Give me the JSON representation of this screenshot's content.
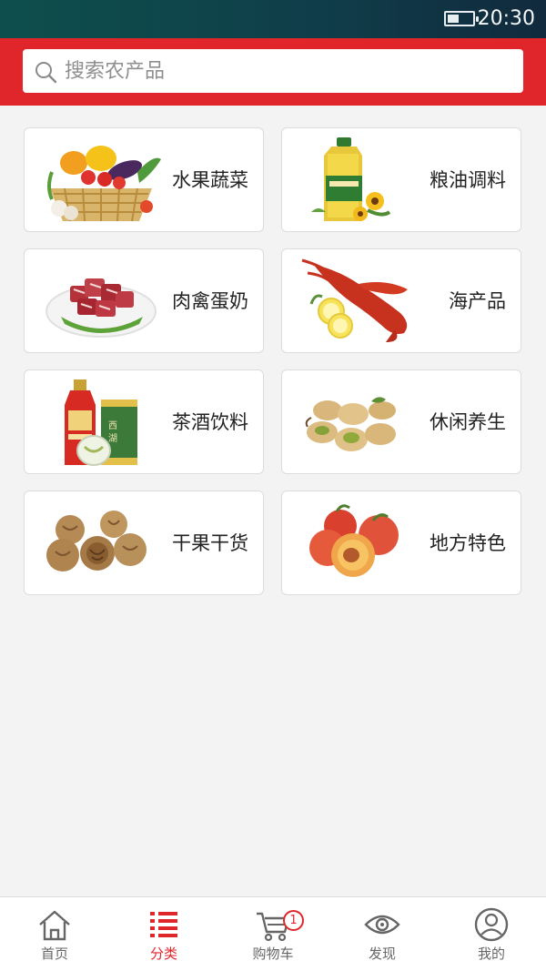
{
  "status_bar": {
    "time": "20:30",
    "battery_icon": "battery-icon"
  },
  "search": {
    "placeholder": "搜索农产品",
    "value": "",
    "icon": "search-icon"
  },
  "categories": [
    {
      "label": "水果蔬菜",
      "icon": "vegetables-basket-image"
    },
    {
      "label": "粮油调料",
      "icon": "cooking-oil-bottle-image"
    },
    {
      "label": "肉禽蛋奶",
      "icon": "meat-plate-image"
    },
    {
      "label": "海产品",
      "icon": "lobster-image"
    },
    {
      "label": "茶酒饮料",
      "icon": "liquor-tea-image"
    },
    {
      "label": "休闲养生",
      "icon": "pistachio-image"
    },
    {
      "label": "干果干货",
      "icon": "walnut-image"
    },
    {
      "label": "地方特色",
      "icon": "peach-image"
    }
  ],
  "tabbar": {
    "items": [
      {
        "label": "首页",
        "icon": "home-icon",
        "active": false
      },
      {
        "label": "分类",
        "icon": "list-icon",
        "active": true
      },
      {
        "label": "购物车",
        "icon": "cart-icon",
        "active": false,
        "badge": "1"
      },
      {
        "label": "发现",
        "icon": "eye-icon",
        "active": false
      },
      {
        "label": "我的",
        "icon": "user-icon",
        "active": false
      }
    ]
  },
  "colors": {
    "brand_red": "#e0262b",
    "status_bar": "#0f3f4a",
    "background": "#f3f3f3"
  }
}
